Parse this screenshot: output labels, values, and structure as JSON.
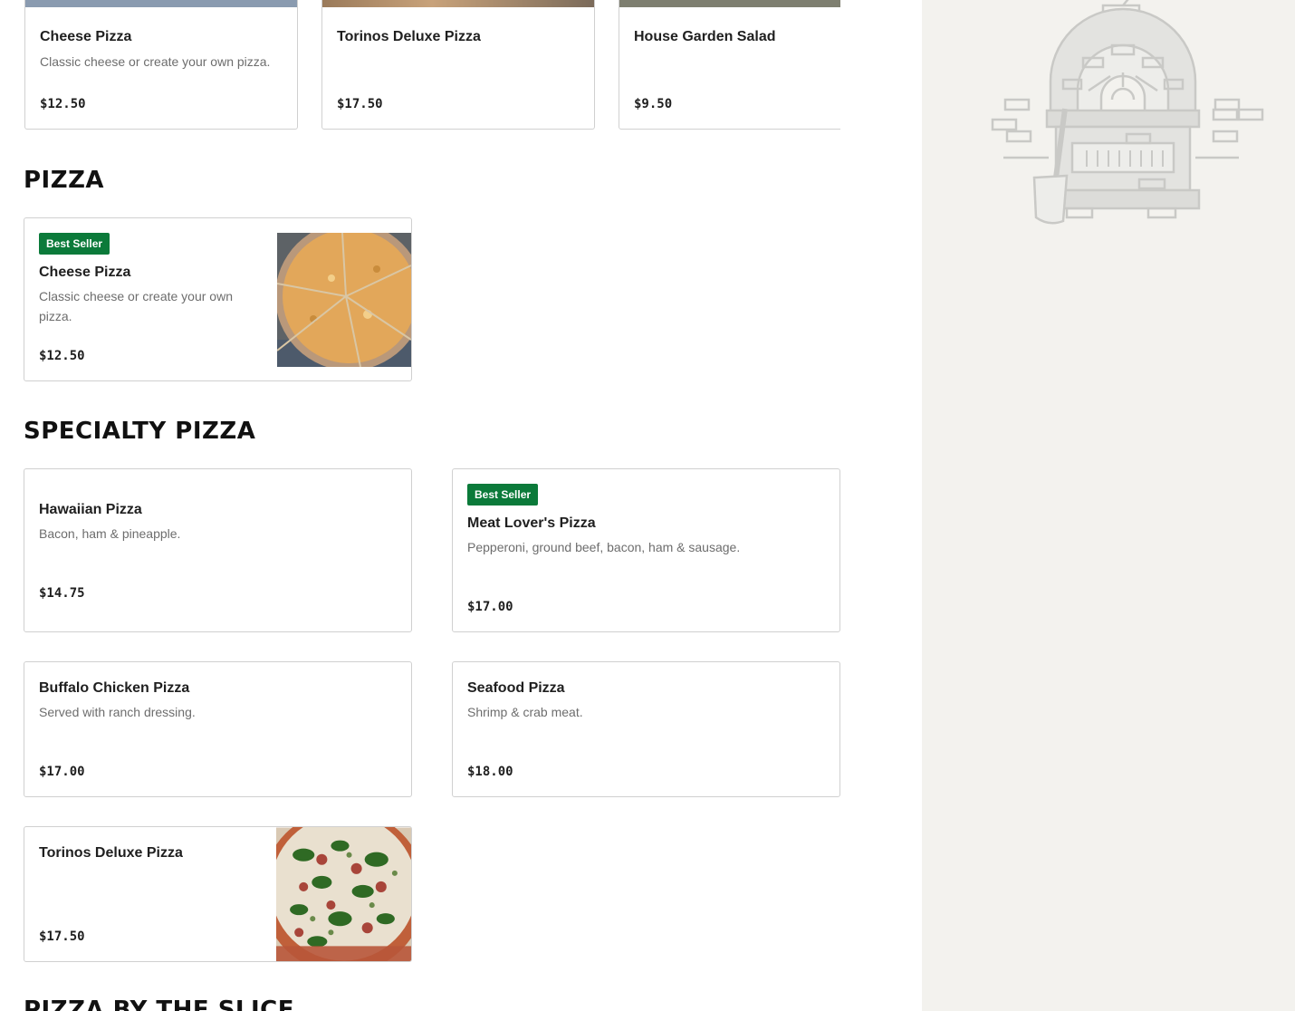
{
  "featured": [
    {
      "name": "Cheese Pizza",
      "description": "Classic cheese or create your own pizza.",
      "price": "$12.50"
    },
    {
      "name": "Torinos Deluxe Pizza",
      "description": "",
      "price": "$17.50"
    },
    {
      "name": "House Garden Salad",
      "description": "",
      "price": "$9.50"
    }
  ],
  "sections": {
    "pizza": {
      "title": "PIZZA",
      "items": [
        {
          "badge": "Best Seller",
          "name": "Cheese Pizza",
          "description": "Classic cheese or create your own pizza.",
          "price": "$12.50",
          "image": "cheese-pizza-photo"
        }
      ]
    },
    "specialty": {
      "title": "SPECIALTY PIZZA",
      "items": [
        {
          "name": "Hawaiian Pizza",
          "description": "Bacon, ham & pineapple.",
          "price": "$14.75"
        },
        {
          "badge": "Best Seller",
          "name": "Meat Lover's Pizza",
          "description": "Pepperoni, ground beef, bacon, ham & sausage.",
          "price": "$17.00"
        },
        {
          "name": "Buffalo Chicken Pizza",
          "description": "Served with ranch dressing.",
          "price": "$17.00"
        },
        {
          "name": "Seafood Pizza",
          "description": "Shrimp & crab meat.",
          "price": "$18.00"
        },
        {
          "name": "Torinos Deluxe Pizza",
          "description": "",
          "price": "$17.50",
          "image": "deluxe-pizza-photo"
        }
      ]
    },
    "slice": {
      "title": "PIZZA BY THE SLICE"
    }
  },
  "sidebar": {
    "illustration": "pizza-oven-icon"
  },
  "colors": {
    "badge": "#0b7a3a",
    "sidebar_bg": "#f3f2ee",
    "border": "#d0d0d0"
  }
}
